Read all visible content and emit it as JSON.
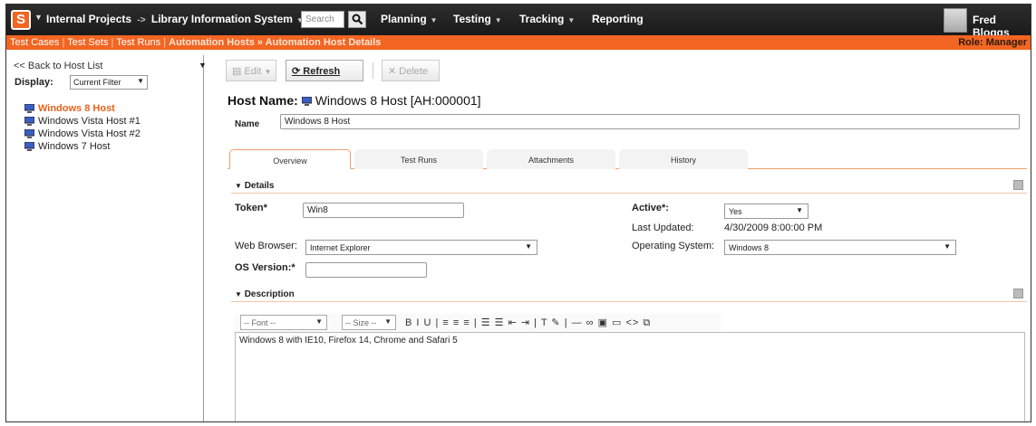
{
  "header": {
    "logo_letter": "S",
    "project": "Internal Projects",
    "arrow": "->",
    "subproject": "Library Information System",
    "search_placeholder": "Search",
    "menu": [
      "Planning",
      "Testing",
      "Tracking",
      "Reporting"
    ],
    "user": "Fred Bloggs"
  },
  "subnav": {
    "links": [
      "Test Cases",
      "Test Sets",
      "Test Runs"
    ],
    "current": "Automation Hosts » Automation Host Details",
    "role": "Role: Manager"
  },
  "sidebar": {
    "back_label": "<< Back to Host List",
    "display_label": "Display:",
    "display_value": "Current Filter",
    "hosts": [
      "Windows 8 Host",
      "Windows Vista Host #1",
      "Windows Vista Host #2",
      "Windows 7 Host"
    ]
  },
  "toolbar": {
    "edit": "Edit",
    "refresh": "Refresh",
    "delete": "Delete"
  },
  "host": {
    "title_label": "Host Name:",
    "title_value": "Windows 8 Host [AH:000001]",
    "name_label": "Name",
    "name_value": "Windows 8 Host"
  },
  "tabs": [
    "Overview",
    "Test Runs",
    "Attachments",
    "History"
  ],
  "details": {
    "heading": "Details",
    "token_label": "Token*",
    "token_value": "Win8",
    "active_label": "Active*:",
    "active_value": "Yes",
    "updated_label": "Last Updated:",
    "updated_value": "4/30/2009 8:00:00 PM",
    "browser_label": "Web Browser:",
    "browser_value": "Internet Explorer",
    "os_label": "Operating System:",
    "os_value": "Windows 8",
    "osver_label": "OS Version:*",
    "osver_value": ""
  },
  "description": {
    "heading": "Description",
    "font_select": "-- Font --",
    "size_select": "-- Size --",
    "tools": "B I U | ≡ ≡ ≡ | ☰ ☰ ⇤ ⇥ | T ✎ | — ∞ ▣ ▭ <> ⧉",
    "text": "Windows 8 with IE10, Firefox 14, Chrome and Safari 5"
  }
}
